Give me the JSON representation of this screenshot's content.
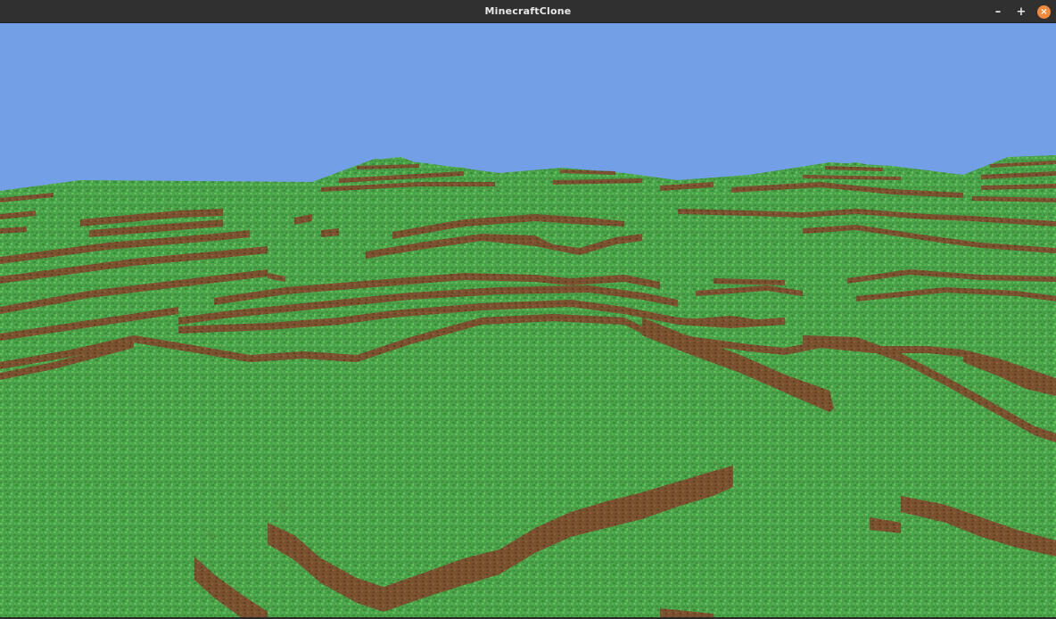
{
  "window": {
    "title": "MinecraftClone",
    "minimize_glyph": "–",
    "maximize_glyph": "+",
    "close_glyph": "×"
  },
  "scene": {
    "sky_color": "#739fe6",
    "grass_color": "#4aa24a",
    "grass_dark": "#3f8f3d",
    "grass_light": "#5fbf5a",
    "dirt_color": "#7a5230",
    "dirt_dark": "#5e3d22"
  },
  "icons": {
    "minimize": "minimize-icon",
    "maximize": "maximize-icon",
    "close": "close-icon"
  }
}
